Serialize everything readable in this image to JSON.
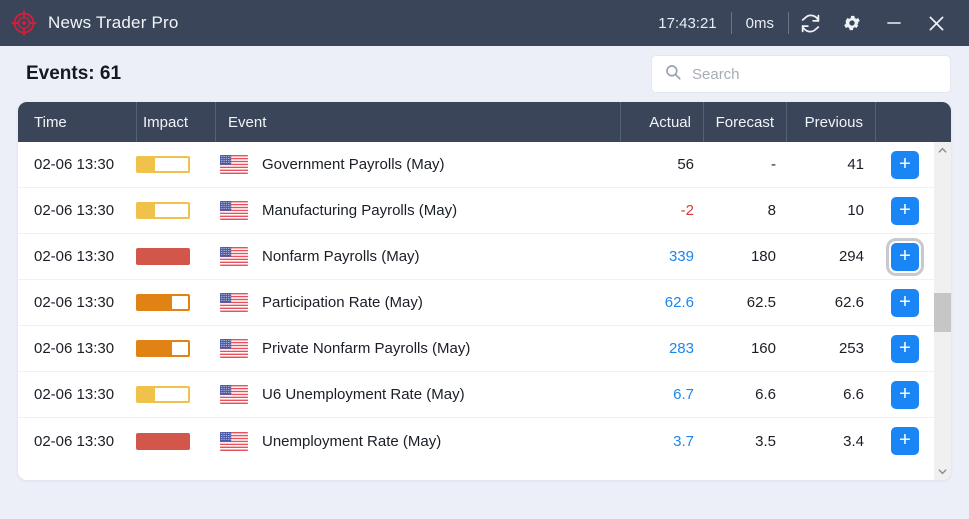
{
  "titlebar": {
    "logo_icon": "crosshair-target-icon",
    "app_title": "News Trader Pro",
    "clock": "17:43:21",
    "latency": "0ms",
    "refresh_icon": "refresh-icon",
    "settings_icon": "gear-icon",
    "minimize_icon": "minimize-icon",
    "close_icon": "close-icon",
    "bg_color": "#3b4559"
  },
  "subheader": {
    "events_count_label": "Events: 61",
    "search": {
      "icon": "search-icon",
      "placeholder": "Search",
      "value": ""
    }
  },
  "table": {
    "columns": [
      "Time",
      "Impact",
      "Event",
      "Actual",
      "Forecast",
      "Previous",
      ""
    ],
    "header_bg": "#3b4559",
    "impact_colors": {
      "low": "#f0c14b",
      "medium": "#e08214",
      "high": "#d2574a"
    },
    "value_colors": {
      "positive": "#1a86f0",
      "negative": "#d93a3a",
      "neutral": "#1a1e26"
    },
    "add_button_label": "+",
    "rows": [
      {
        "time": "02-06 13:30",
        "impact_level": "low",
        "impact_fill_pct": 33,
        "country_flag": "us-flag-icon",
        "event": "Government Payrolls (May)",
        "actual": "56",
        "actual_tone": "neutral",
        "forecast": "-",
        "previous": "41",
        "add_focused": false
      },
      {
        "time": "02-06 13:30",
        "impact_level": "low",
        "impact_fill_pct": 33,
        "country_flag": "us-flag-icon",
        "event": "Manufacturing Payrolls (May)",
        "actual": "-2",
        "actual_tone": "negative",
        "forecast": "8",
        "previous": "10",
        "add_focused": false
      },
      {
        "time": "02-06 13:30",
        "impact_level": "high",
        "impact_fill_pct": 100,
        "country_flag": "us-flag-icon",
        "event": "Nonfarm Payrolls (May)",
        "actual": "339",
        "actual_tone": "positive",
        "forecast": "180",
        "previous": "294",
        "add_focused": true
      },
      {
        "time": "02-06 13:30",
        "impact_level": "medium",
        "impact_fill_pct": 67,
        "country_flag": "us-flag-icon",
        "event": "Participation Rate (May)",
        "actual": "62.6",
        "actual_tone": "positive",
        "forecast": "62.5",
        "previous": "62.6",
        "add_focused": false
      },
      {
        "time": "02-06 13:30",
        "impact_level": "medium",
        "impact_fill_pct": 67,
        "country_flag": "us-flag-icon",
        "event": "Private Nonfarm Payrolls (May)",
        "actual": "283",
        "actual_tone": "positive",
        "forecast": "160",
        "previous": "253",
        "add_focused": false
      },
      {
        "time": "02-06 13:30",
        "impact_level": "low",
        "impact_fill_pct": 33,
        "country_flag": "us-flag-icon",
        "event": "U6 Unemployment Rate (May)",
        "actual": "6.7",
        "actual_tone": "positive",
        "forecast": "6.6",
        "previous": "6.6",
        "add_focused": false
      },
      {
        "time": "02-06 13:30",
        "impact_level": "high",
        "impact_fill_pct": 100,
        "country_flag": "us-flag-icon",
        "event": "Unemployment Rate (May)",
        "actual": "3.7",
        "actual_tone": "positive",
        "forecast": "3.5",
        "previous": "3.4",
        "add_focused": false
      }
    ],
    "scrollbar": {
      "up_icon": "chevron-up-icon",
      "down_icon": "chevron-down-icon",
      "thumb_top_pct": 44,
      "thumb_height_pct": 13
    }
  }
}
